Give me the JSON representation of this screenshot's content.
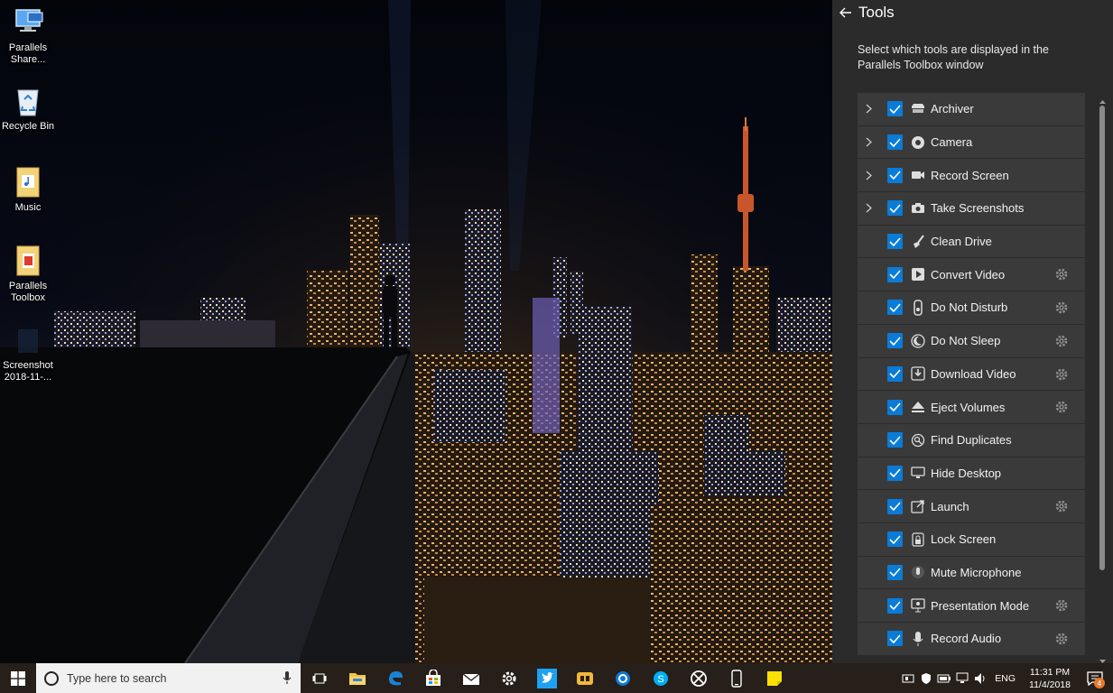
{
  "desktop": {
    "icons": [
      {
        "label": "Parallels Share...",
        "icon": "computer-share-icon"
      },
      {
        "label": "Recycle Bin",
        "icon": "recycle-bin-icon"
      },
      {
        "label": "Music",
        "icon": "folder-music-icon"
      },
      {
        "label": "Parallels Toolbox",
        "icon": "folder-toolbox-icon"
      },
      {
        "label": "Screenshot 2018-11-...",
        "icon": "screenshot-file-icon"
      }
    ]
  },
  "panel": {
    "title": "Tools",
    "description": "Select which tools are displayed in the Parallels Toolbox window",
    "tools": [
      {
        "label": "Archiver",
        "expandable": true,
        "checked": true,
        "settings": false,
        "icon": "archiver-icon"
      },
      {
        "label": "Camera",
        "expandable": true,
        "checked": true,
        "settings": false,
        "icon": "camera-icon"
      },
      {
        "label": "Record Screen",
        "expandable": true,
        "checked": true,
        "settings": false,
        "icon": "video-camera-icon"
      },
      {
        "label": "Take Screenshots",
        "expandable": true,
        "checked": true,
        "settings": false,
        "icon": "photo-camera-icon"
      },
      {
        "label": "Clean Drive",
        "expandable": false,
        "checked": true,
        "settings": false,
        "icon": "broom-icon"
      },
      {
        "label": "Convert Video",
        "expandable": false,
        "checked": true,
        "settings": true,
        "icon": "convert-video-icon"
      },
      {
        "label": "Do Not Disturb",
        "expandable": false,
        "checked": true,
        "settings": true,
        "icon": "do-not-disturb-icon"
      },
      {
        "label": "Do Not Sleep",
        "expandable": false,
        "checked": true,
        "settings": true,
        "icon": "moon-icon"
      },
      {
        "label": "Download Video",
        "expandable": false,
        "checked": true,
        "settings": true,
        "icon": "download-video-icon"
      },
      {
        "label": "Eject Volumes",
        "expandable": false,
        "checked": true,
        "settings": true,
        "icon": "eject-icon"
      },
      {
        "label": "Find Duplicates",
        "expandable": false,
        "checked": true,
        "settings": false,
        "icon": "find-duplicates-icon"
      },
      {
        "label": "Hide Desktop",
        "expandable": false,
        "checked": true,
        "settings": false,
        "icon": "hide-desktop-icon"
      },
      {
        "label": "Launch",
        "expandable": false,
        "checked": true,
        "settings": true,
        "icon": "launch-icon"
      },
      {
        "label": "Lock Screen",
        "expandable": false,
        "checked": true,
        "settings": false,
        "icon": "lock-icon"
      },
      {
        "label": "Mute Microphone",
        "expandable": false,
        "checked": true,
        "settings": false,
        "icon": "microphone-mute-icon"
      },
      {
        "label": "Presentation Mode",
        "expandable": false,
        "checked": true,
        "settings": true,
        "icon": "presentation-icon"
      },
      {
        "label": "Record Audio",
        "expandable": false,
        "checked": true,
        "settings": true,
        "icon": "microphone-icon"
      }
    ]
  },
  "taskbar": {
    "search_placeholder": "Type here to search",
    "apps": [
      "task-view-icon",
      "file-explorer-icon",
      "edge-icon",
      "store-icon",
      "mail-icon",
      "settings-icon",
      "twitter-icon",
      "parallels-app-icon",
      "skype-business-icon",
      "skype-icon",
      "xbox-icon",
      "phone-icon",
      "sticky-notes-icon"
    ],
    "language": "ENG",
    "time": "11:31 PM",
    "date": "11/4/2018",
    "notification_count": "4"
  },
  "colors": {
    "checkbox": "#0a7bd6",
    "panel_bg": "#2b2b2b",
    "row_bg": "#3a3a3a",
    "taskbar_bg": "#261f1a"
  }
}
